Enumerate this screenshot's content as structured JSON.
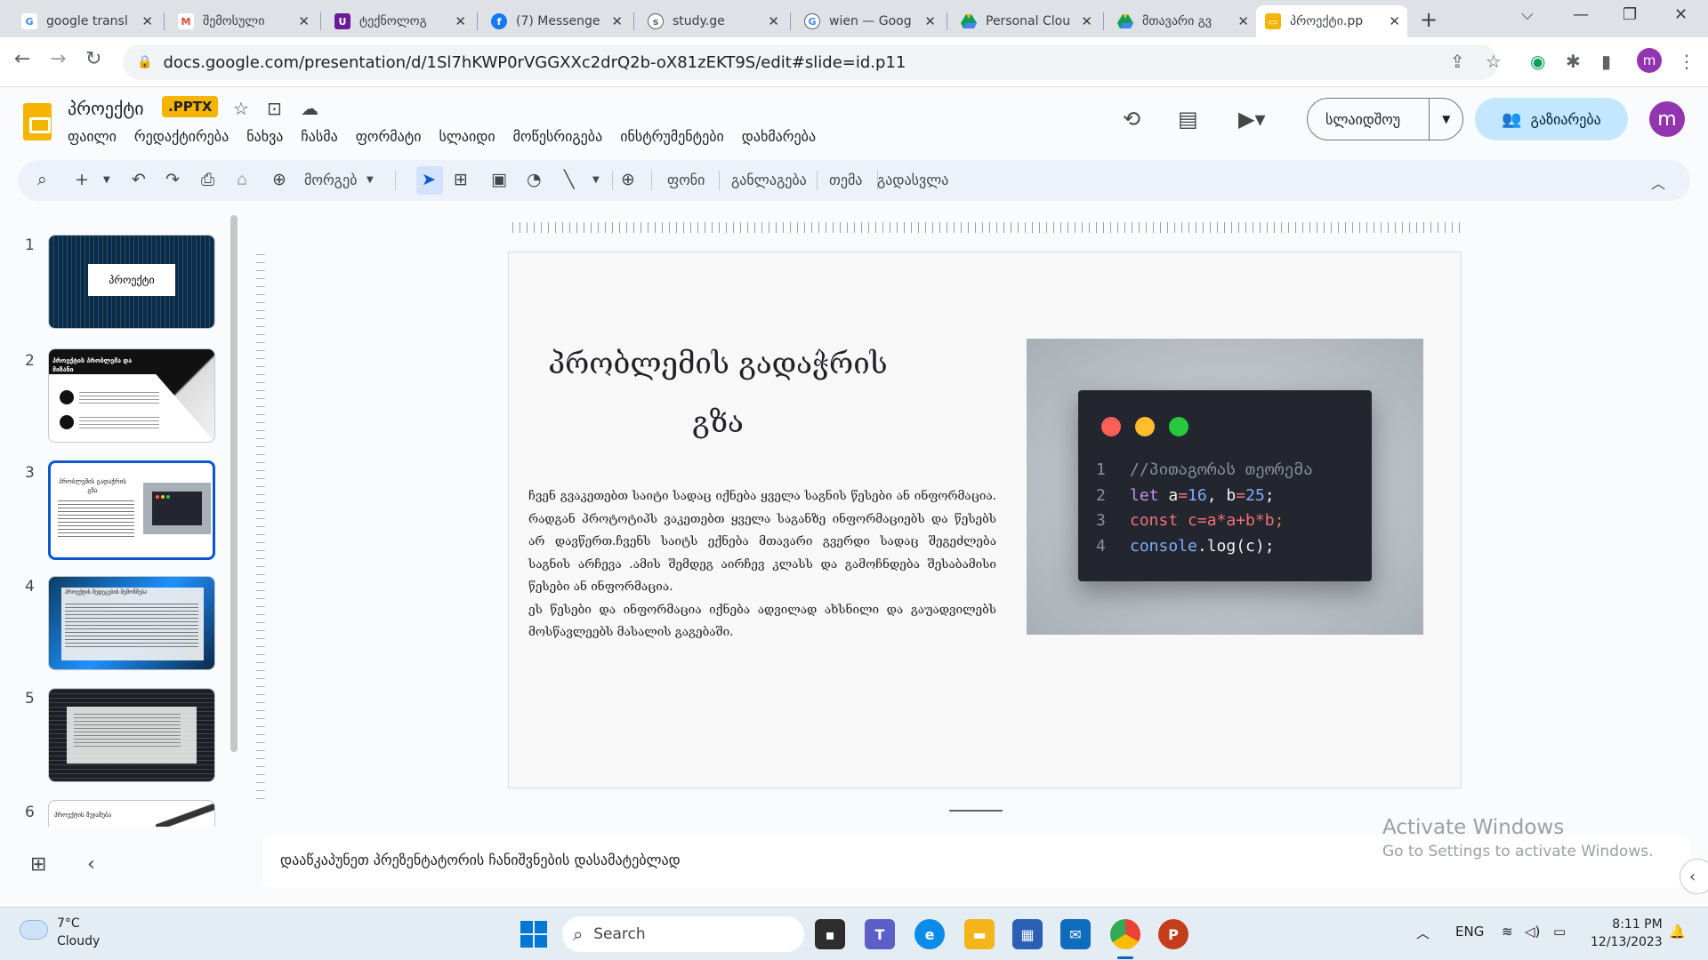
{
  "browser": {
    "tabs": [
      {
        "label": "google transl",
        "favicon": "google-icon",
        "color": "#4285f4"
      },
      {
        "label": "შემოსული",
        "favicon": "gmail-icon",
        "color": "#ea4335"
      },
      {
        "label": "ტექნოლოგ",
        "favicon": "university-icon",
        "color": "#6a1b9a"
      },
      {
        "label": "(7) Messenge",
        "favicon": "facebook-icon",
        "color": "#1877f2"
      },
      {
        "label": "study.ge",
        "favicon": "study-icon",
        "color": "#5f6368"
      },
      {
        "label": "wien — Goog",
        "favicon": "google-icon",
        "color": "#4285f4"
      },
      {
        "label": "Personal Clou",
        "favicon": "drive-icon",
        "color": "#0f9d58"
      },
      {
        "label": "მთავარი გვ",
        "favicon": "drive-icon",
        "color": "#0f9d58"
      },
      {
        "label": "პროექტი.pp",
        "favicon": "slides-icon",
        "color": "#f4b400"
      }
    ],
    "url": "docs.google.com/presentation/d/1Sl7hKWP0rVGGXXc2drQ2b-oX81zEKT9S/edit#slide=id.p11",
    "profile_initial": "m"
  },
  "app": {
    "title": "პროექტი",
    "badge": ".PPTX",
    "menu": [
      "ფაილი",
      "რედაქტირება",
      "ნახვა",
      "ჩასმა",
      "ფორმატი",
      "სლაიდი",
      "მოწესრიგება",
      "ინსტრუმენტები",
      "დახმარება"
    ],
    "slideshow_label": "სლაიდშოუ",
    "share_label": "გაზიარება",
    "user_initial": "m"
  },
  "toolbar": {
    "zoom_label": "მორგებ",
    "background_label": "ფონი",
    "layout_label": "განლაგება",
    "theme_label": "თემა",
    "transition_label": "გადასვლა"
  },
  "filmstrip": {
    "slide_numbers": [
      "1",
      "2",
      "3",
      "4",
      "5",
      "6"
    ],
    "selected": 3,
    "thumb1_title": "პროექტი",
    "thumb2_title": "პროექტის პრობლემა და მიზანი",
    "thumb3_title": "პრობლემის გადაჭრის გზა",
    "thumb4_title": "პროექტის შედეგების შემოწმება",
    "thumb6_title": "პროექტის შეჯამება"
  },
  "slide": {
    "title": "პრობლემის გადაჭრის გზა",
    "body_p1": "ჩვენ გვაკეთებთ საიტი სადაც იქნება ყველა საგნის წესები ან ინფორმაცია. რადგან პროტოტიპს ვაკეთებთ ყველა საგანზე ინფორმაციებს და წესებს არ დავწერთ.ჩვენს საიტს ექნება მთავარი გვერდი სადაც შეგეძლება საგნის არჩევა .ამის შემდეგ აირჩევ კლასს და გამოჩნდება შესაბამისი წესები ან ინფორმაცია.",
    "body_p2": "ეს წესები და ინფორმაცია იქნება ადვილად ახსნილი და გაუადვილებს მოსწავლეებს მასალის გაგებაში.",
    "code": {
      "line_numbers": [
        "1",
        "2",
        "3",
        "4"
      ],
      "comment": "//პითაგორას თეორემა",
      "let_kw": "let",
      "a": "a",
      "eq": "=",
      "a_val": "16",
      "comma": ", ",
      "b": "b",
      "b_val": "25",
      "semi": ";",
      "const_kw": "const",
      "expr": "c=a*a+b*b;",
      "console": "console",
      "log": ".log(c);"
    }
  },
  "notes": {
    "placeholder": "დააწკაპუნეთ პრეზენტატორის ჩანიშვნების დასამატებლად"
  },
  "watermark": {
    "line1": "Activate Windows",
    "line2": "Go to Settings to activate Windows."
  },
  "taskbar": {
    "temperature": "7°C",
    "weather": "Cloudy",
    "search_label": "Search",
    "language": "ENG",
    "time": "8:11 PM",
    "date": "12/13/2023"
  }
}
